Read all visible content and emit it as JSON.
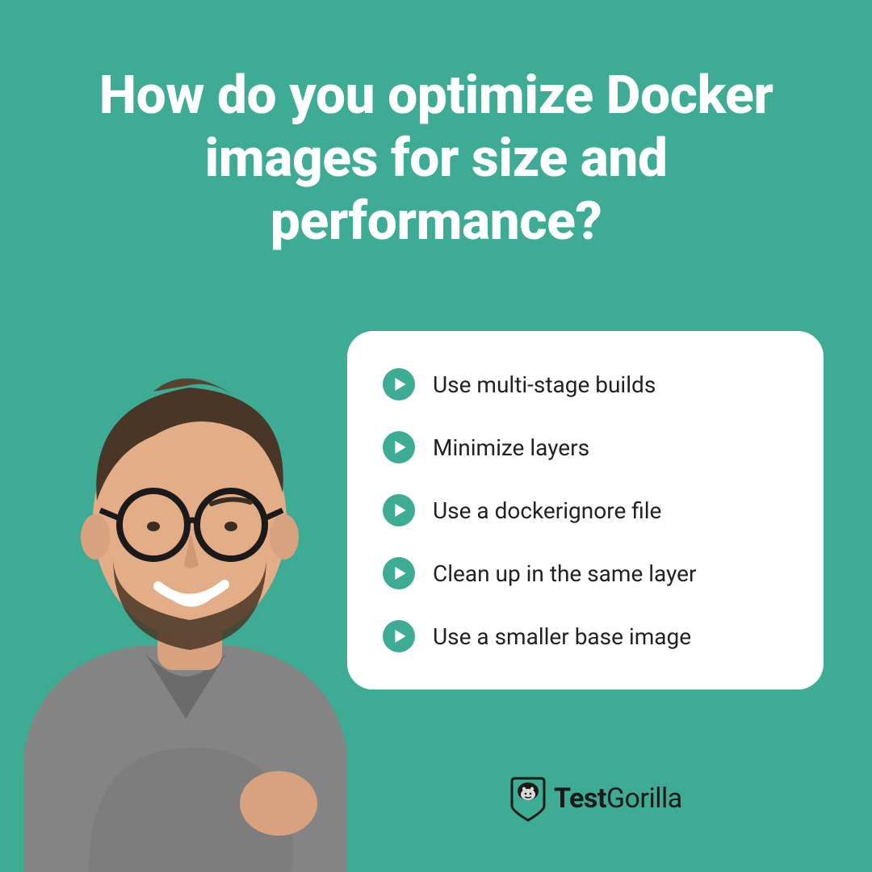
{
  "title": "How do you optimize Docker images for size and performance?",
  "bullets": [
    "Use multi-stage builds",
    "Minimize layers",
    "Use a dockerignore file",
    "Clean up in the same layer",
    "Use a smaller base image"
  ],
  "brand": {
    "name_bold": "Test",
    "name_light": "Gorilla"
  },
  "colors": {
    "bg": "#3eab95",
    "card": "#ffffff",
    "text": "#222222",
    "title": "#ffffff"
  }
}
